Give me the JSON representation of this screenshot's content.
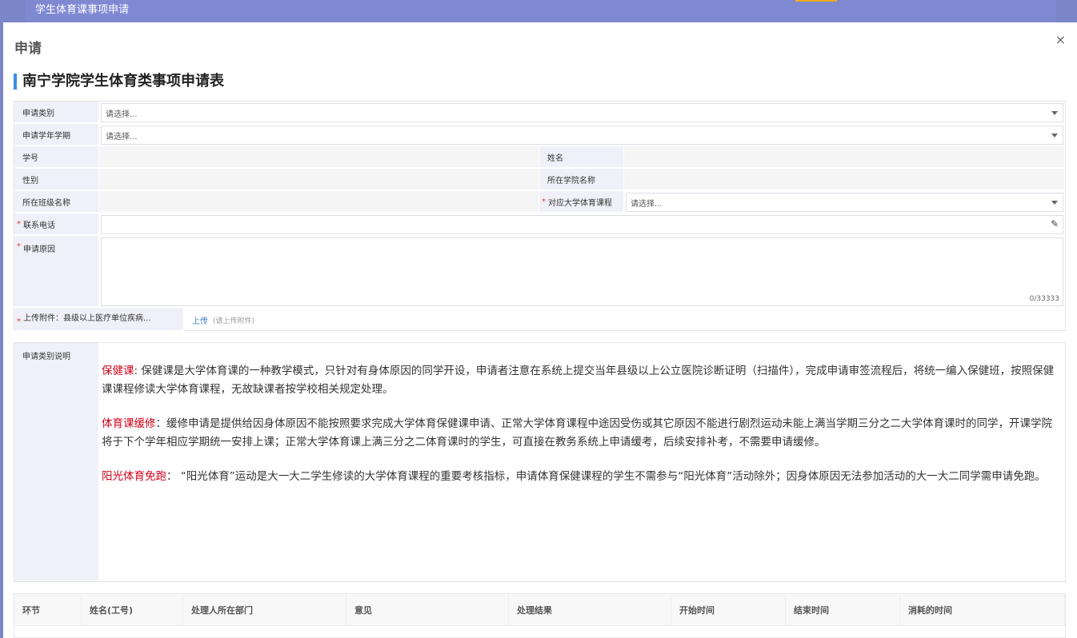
{
  "background": {
    "tab_title": "学生体育课事项申请"
  },
  "dialog": {
    "title": "申请",
    "close_icon": "×"
  },
  "form": {
    "title": "南宁学院学生体育类事项申请表",
    "apply_type": {
      "label": "申请类别",
      "placeholder": "请选择..."
    },
    "term": {
      "label": "申请学年学期",
      "placeholder": "请选择..."
    },
    "student_id": {
      "label": "学号",
      "value": ""
    },
    "name": {
      "label": "姓名",
      "value": ""
    },
    "gender": {
      "label": "性别",
      "value": ""
    },
    "college": {
      "label": "所在学院名称",
      "value": ""
    },
    "class_name": {
      "label": "所在班级名称",
      "value": ""
    },
    "course": {
      "label": "对应大学体育课程",
      "placeholder": "请选择...",
      "required": "*"
    },
    "phone": {
      "label": "联系电话",
      "required": "*",
      "value": ""
    },
    "reason": {
      "label": "申请原因",
      "required": "*",
      "counter": "0/33333"
    },
    "attachment": {
      "label": "上传附件：县级以上医疗单位疾病...",
      "required": "*",
      "upload_label": "上传",
      "hint": "(请上传附件)"
    }
  },
  "description": {
    "label": "申请类别说明",
    "items": [
      {
        "title": "保健课",
        "sep": ":  ",
        "text": "保健课是大学体育课的一种教学模式，只针对有身体原因的同学开设，申请者注意在系统上提交当年县级以上公立医院诊断证明（扫描件），完成申请审签流程后，将统一编入保健班，按照保健课课程修读大学体育课程，无故缺课者按学校相关规定处理。"
      },
      {
        "title": "体育课缓修",
        "sep": "：",
        "text": "缓修申请是提供给因身体原因不能按照要求完成大学体育保健课申请、正常大学体育课程中途因受伤或其它原因不能进行剧烈运动未能上满当学期三分之二大学体育课时的同学，开课学院将于下个学年相应学期统一安排上课；正常大学体育课上满三分之二体育课时的学生，可直接在教务系统上申请缓考，后续安排补考，不需要申请缓修。"
      },
      {
        "title": "阳光体育免跑",
        "sep": "：   ",
        "text": "“阳光体育”运动是大一大二学生修读的大学体育课程的重要考核指标，申请体育保健课程的学生不需参与“阳光体育”活动除外；因身体原因无法参加活动的大一大二同学需申请免跑。"
      }
    ]
  },
  "flow_table": {
    "columns": [
      "环节",
      "姓名(工号)",
      "处理人所在部门",
      "意见",
      "处理结果",
      "开始时间",
      "结束时间",
      "消耗的时间"
    ]
  }
}
